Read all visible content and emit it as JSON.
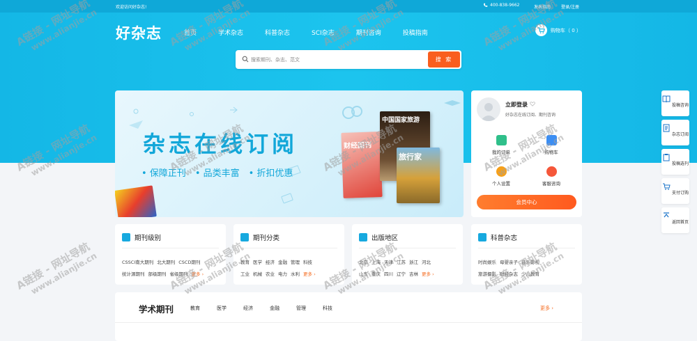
{
  "topbar": {
    "welcome": "欢迎访问好杂志!",
    "phone": "400-838-9662",
    "links": [
      "发表指南",
      "登录/注册"
    ]
  },
  "logo": "好杂志",
  "nav": [
    "首页",
    "学术杂志",
    "科普杂志",
    "SCI杂志",
    "期刊咨询",
    "投稿指南"
  ],
  "cart": {
    "label": "购物车（ 0 ）"
  },
  "search": {
    "placeholder": "搜索期刊、杂志、范文",
    "button": "搜 索"
  },
  "banner": {
    "title": "杂志在线订阅",
    "features": [
      "• 保障正刊",
      "• 品类丰富",
      "• 折扣优惠"
    ],
    "magazines": [
      "中国国家旅游",
      "财经国刊",
      "旅行家"
    ]
  },
  "login": {
    "title": "立即登录",
    "subtitle": "好杂志在线订阅、期刊咨询",
    "links": [
      "我的订单",
      "购物车",
      "个人设置",
      "客服咨询"
    ],
    "member_button": "会员中心"
  },
  "categories": [
    {
      "title": "期刊级别",
      "items": [
        "CSSCI南大期刊",
        "北大期刊",
        "CSCD期刊",
        "统计源期刊",
        "部级期刊",
        "省级期刊"
      ],
      "more": "更多 ›"
    },
    {
      "title": "期刊分类",
      "items": [
        "教育",
        "医学",
        "经济",
        "金融",
        "管理",
        "科技",
        "工业",
        "机械",
        "农业",
        "电力",
        "水利"
      ],
      "more": "更多 ›"
    },
    {
      "title": "出版地区",
      "items": [
        "北京",
        "上海",
        "天津",
        "江苏",
        "浙江",
        "河北",
        "山东",
        "重庆",
        "四川",
        "辽宁",
        "吉林"
      ],
      "more": "更多 ›"
    },
    {
      "title": "科普杂志",
      "items": [
        "时尚娱乐",
        "母婴亲子",
        "音乐影视",
        "旅游摄影",
        "财经杂志",
        "少儿教育"
      ]
    }
  ],
  "academic": {
    "title": "学术期刊",
    "tabs": [
      "教育",
      "医学",
      "经济",
      "金融",
      "管理",
      "科技"
    ],
    "more": "更多 ›"
  },
  "sidebar": [
    "投稿咨询",
    "杂志订阅",
    "投稿选刊",
    "支付订购",
    "返回首页"
  ],
  "watermark": {
    "line1": "A链接 - 网址导航",
    "line2": "www.alianjie.cn"
  },
  "colors": {
    "primary": "#14b7e6",
    "accent": "#f95e1e"
  }
}
